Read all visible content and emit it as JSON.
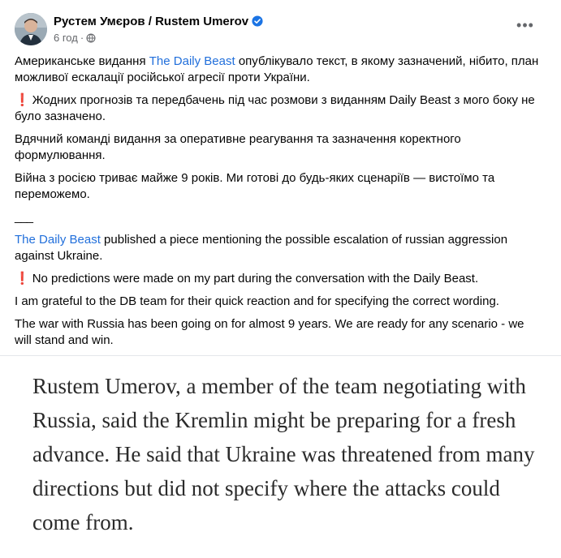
{
  "post": {
    "author": "Рустем Умєров / Rustem Umerov",
    "time": "6 год",
    "separator": "·",
    "more_label": "•••"
  },
  "body": {
    "uk": {
      "p1_prefix": "Американське видання ",
      "p1_link": "The Daily Beast",
      "p1_suffix": "  опублікувало текст, в якому зазначений, нібито, план можливої ескалації російської агресії проти України.",
      "p2_mark": "❗",
      "p2": "Жодних прогнозів та передбачень під час розмови з виданням Daily Beast з мого боку не було зазначено.",
      "p3": "Вдячний команді видання за оперативне реагування та зазначення коректного формулювання.",
      "p4": "Війна з росією триває майже 9 років. Ми готові до будь-яких сценаріїв — вистоїмо та переможемо."
    },
    "divider": "___",
    "en": {
      "p1_link": "The Daily Beast",
      "p1_suffix": " published a piece mentioning the possible escalation of russian aggression against Ukraine.",
      "p2_mark": "❗",
      "p2": "No predictions were made on my part during the conversation with the Daily Beast.",
      "p3": "I am grateful to the DB team for their quick reaction and for specifying the correct wording.",
      "p4": "The war with Russia has been going on for almost 9 years. We are ready for any scenario - we will stand and win."
    }
  },
  "quote": {
    "text": "Rustem Umerov, a member of the team negotiating with Russia, said the Kremlin might be preparing for a fresh advance. He said that Ukraine was threatened from many directions but did not specify where the attacks could come from."
  },
  "colors": {
    "link": "#216fdb",
    "verified": "#1b74e4",
    "meta": "#65676b",
    "exclaim": "#e02424"
  },
  "icons": {
    "verified": "verified-badge-icon",
    "globe": "globe-icon",
    "more": "more-options-icon"
  }
}
